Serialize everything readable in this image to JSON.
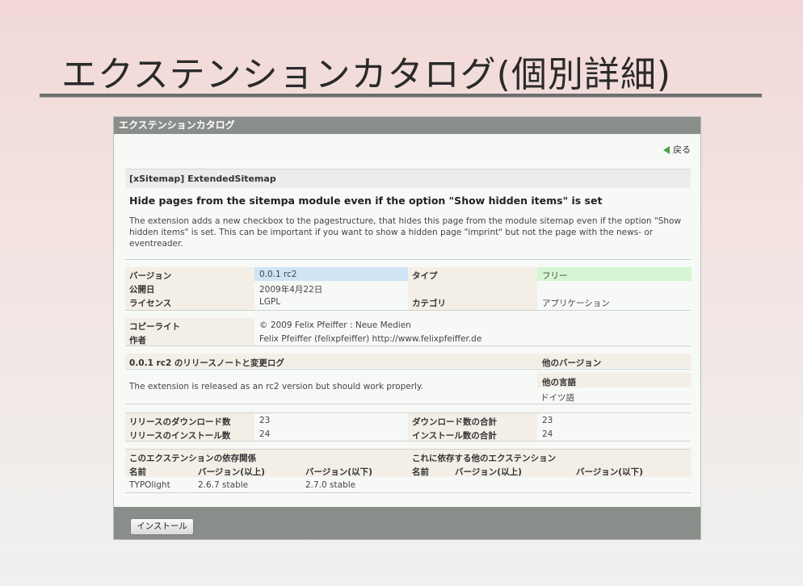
{
  "slide": {
    "title": "エクステンションカタログ(個別詳細)"
  },
  "panel": {
    "header": "エクステンションカタログ",
    "back_label": "戻る",
    "ext_name": "[xSitemap] ExtendedSitemap",
    "ext_title": "Hide pages from the sitempa module even if the option \"Show hidden items\" is set",
    "ext_desc": "The extension adds a new checkbox to the pagestructure, that hides this page from the module sitemap even if the option \"Show hidden items\" is set. This can be important if you want to show a hidden page \"imprint\" but not the page with the news- or eventreader.",
    "info": {
      "version_label": "バージョン",
      "version": "0.0.1 rc2",
      "type_label": "タイプ",
      "type": "フリー",
      "published_label": "公開日",
      "published": "2009年4月22日",
      "license_label": "ライセンス",
      "license": "LGPL",
      "category_label": "カテゴリ",
      "category": "アプリケーション",
      "copyright_label": "コピーライト",
      "copyright": "© 2009 Felix Pfeiffer : Neue Medien",
      "author_label": "作者",
      "author": "Felix Pfeiffer (felixpfeiffer) http://www.felixpfeiffer.de"
    },
    "release": {
      "notes_label": "0.0.1 rc2 のリリースノートと変更ログ",
      "other_versions_label": "他のバージョン",
      "notes": "The extension is released as an rc2 version but should work properly.",
      "other_langs_label": "他の言語",
      "other_lang": "ドイツ語"
    },
    "stats": {
      "release_dl_label": "リリースのダウンロード数",
      "release_dl": "23",
      "total_dl_label": "ダウンロード数の合計",
      "total_dl": "23",
      "release_inst_label": "リリースのインストール数",
      "release_inst": "24",
      "total_inst_label": "インストール数の合計",
      "total_inst": "24"
    },
    "deps": {
      "depends_label": "このエクステンションの依存関係",
      "dependents_label": "これに依存する他のエクステンション",
      "col_name": "名前",
      "col_min": "バージョン(以上)",
      "col_max": "バージョン(以下)",
      "rows": [
        {
          "name": "TYPOlight",
          "min": "2.6.7 stable",
          "max": "2.7.0 stable"
        }
      ]
    },
    "install_label": "インストール"
  }
}
